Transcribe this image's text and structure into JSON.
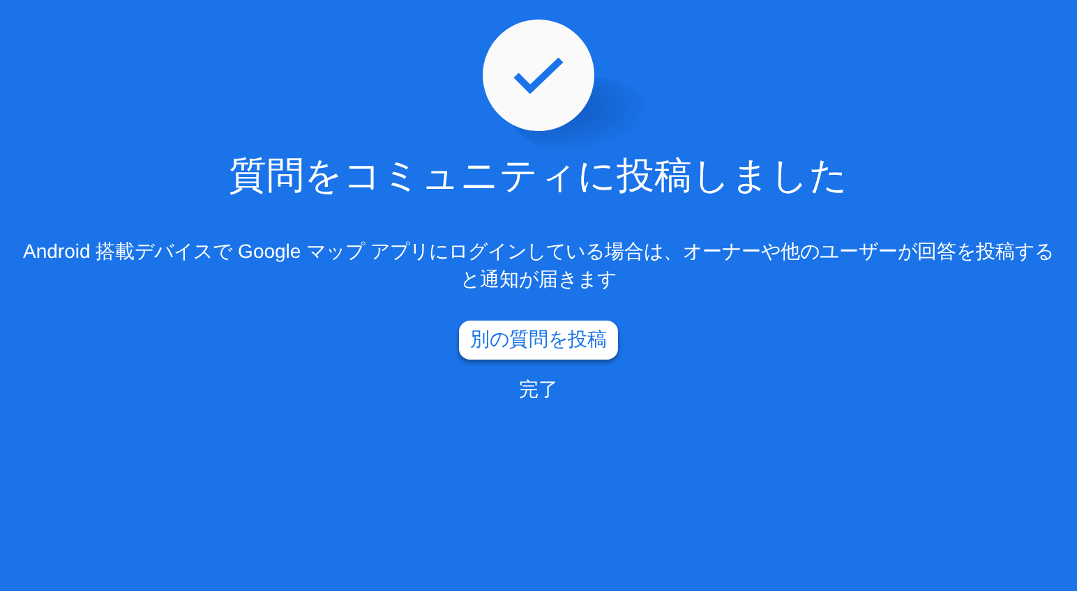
{
  "title": "質問をコミュニティに投稿しました",
  "message": "Android 搭載デバイスで Google マップ アプリにログインしている場合は、オーナーや他のユーザーが回答を投稿すると通知が届きます",
  "buttons": [
    {
      "label": "別の質問を投稿",
      "kind": "raised"
    },
    {
      "label": "完了",
      "kind": "text"
    }
  ]
}
